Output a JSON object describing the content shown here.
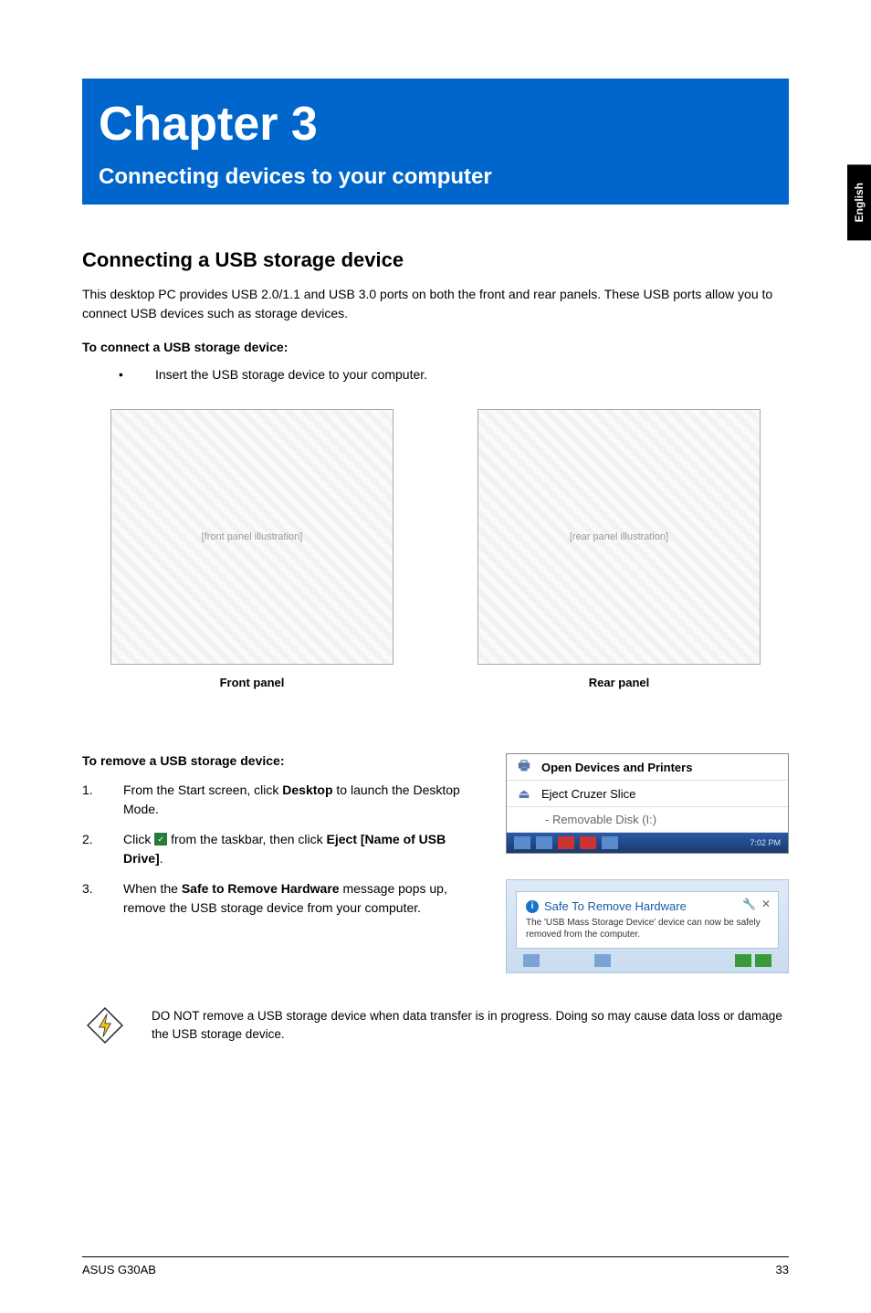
{
  "sidetab": "English",
  "chapter": {
    "title": "Chapter 3",
    "subtitle": "Connecting devices to your computer"
  },
  "section1": {
    "heading": "Connecting a USB storage device",
    "intro": "This desktop PC provides USB 2.0/1.1 and USB 3.0 ports on both the front and rear panels. These USB ports allow you to connect USB devices such as storage devices.",
    "connect_heading": "To connect a USB storage device:",
    "bullet": "Insert the USB storage device to your computer.",
    "front_caption": "Front panel",
    "rear_caption": "Rear panel",
    "front_placeholder": "[front panel illustration]",
    "rear_placeholder": "[rear panel illustration]"
  },
  "section2": {
    "heading": "To remove a USB storage device:",
    "step1_pre": "From the Start screen, click ",
    "step1_bold": "Desktop",
    "step1_post": " to launch the Desktop Mode.",
    "step2_pre": "Click ",
    "step2_mid": " from the taskbar, then click ",
    "step2_bold": "Eject [Name of USB Drive]",
    "step2_post": ".",
    "step3_pre": "When the ",
    "step3_bold": "Safe to Remove Hardware",
    "step3_post": " message pops up, remove the USB storage device from your computer."
  },
  "popup1": {
    "open_devices": "Open Devices and Printers",
    "eject": "Eject Cruzer Slice",
    "sub": "-   Removable Disk (I:)",
    "time": "7:02 PM"
  },
  "popup2": {
    "title": "Safe To Remove Hardware",
    "body": "The 'USB Mass Storage Device' device can now be safely removed from the computer."
  },
  "warning": "DO NOT remove a USB storage device when data transfer is in progress. Doing so may cause data loss or damage the USB storage device.",
  "footer": {
    "left": "ASUS G30AB",
    "right": "33"
  }
}
